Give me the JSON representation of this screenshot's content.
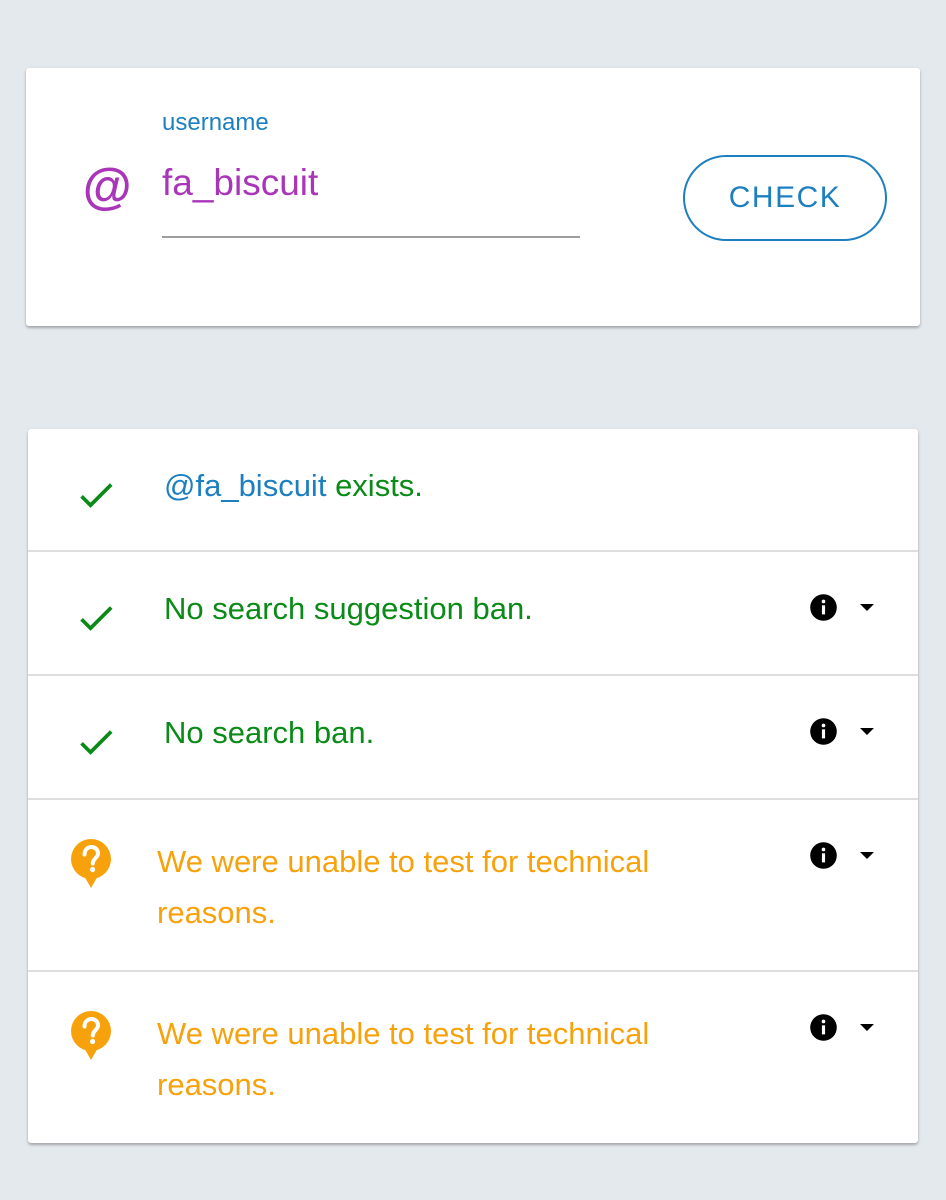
{
  "search": {
    "label": "username",
    "at_symbol": "@",
    "value": "fa_biscuit",
    "button_label": "CHECK"
  },
  "results": [
    {
      "status": "ok",
      "icon": "check-icon",
      "handle": "@fa_biscuit",
      "text": "exists.",
      "has_info": false
    },
    {
      "status": "ok",
      "icon": "check-icon",
      "text": "No search suggestion ban.",
      "has_info": true
    },
    {
      "status": "ok",
      "icon": "check-icon",
      "text": "No search ban.",
      "has_info": true
    },
    {
      "status": "unknown",
      "icon": "question-icon",
      "text": "We were unable to test for technical reasons.",
      "has_info": true
    },
    {
      "status": "unknown",
      "icon": "question-icon",
      "text": "We were unable to test for technical reasons.",
      "has_info": true
    }
  ],
  "colors": {
    "background": "#e4e9ee",
    "accent_blue": "#1d7fc0",
    "accent_purple": "#a935b9",
    "success_green": "#0a8a17",
    "warning_orange": "#f7a20c"
  }
}
